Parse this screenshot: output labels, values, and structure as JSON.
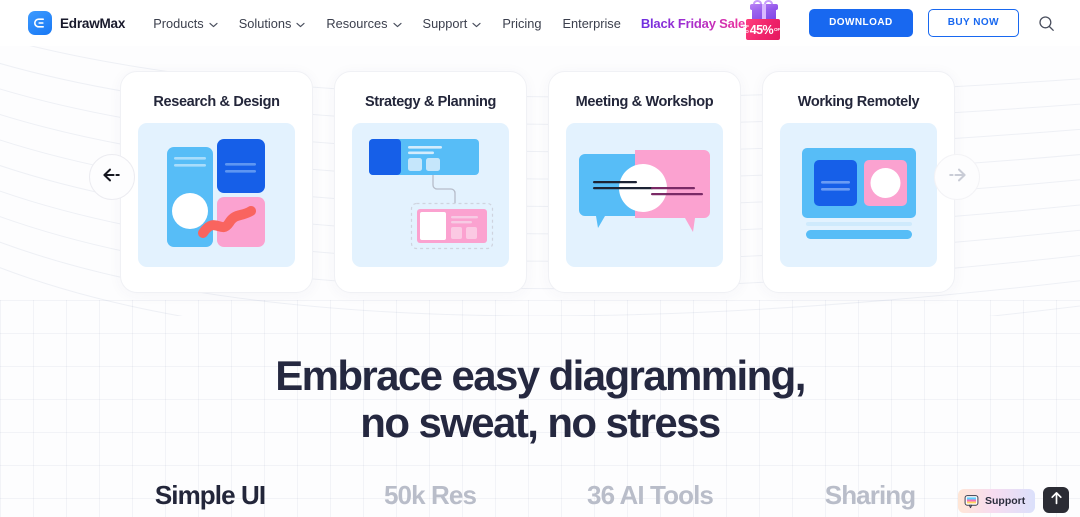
{
  "header": {
    "brand": {
      "name": "EdrawMax",
      "logo_icon": "edrawmax-logo-icon"
    },
    "nav": [
      {
        "label": "Products",
        "has_dropdown": true
      },
      {
        "label": "Solutions",
        "has_dropdown": true
      },
      {
        "label": "Resources",
        "has_dropdown": true
      },
      {
        "label": "Support",
        "has_dropdown": true
      },
      {
        "label": "Pricing",
        "has_dropdown": false
      },
      {
        "label": "Enterprise",
        "has_dropdown": false
      }
    ],
    "promo": {
      "text": "Black Friday Sale",
      "badge_upto": "UP TO",
      "badge_percent": "45%",
      "badge_off": "OFF",
      "icon": "gift-box-icon",
      "gradient_from": "#6d2fe0",
      "gradient_to": "#f0309b"
    },
    "download_label": "DOWNLOAD",
    "buy_label": "BUY NOW",
    "search_icon": "search-icon",
    "accent_color": "#1868f0"
  },
  "carousel": {
    "prev_icon": "arrow-left-icon",
    "next_icon": "arrow-right-icon",
    "prev_enabled": true,
    "next_enabled": false,
    "cards": [
      {
        "title": "Research & Design",
        "art": "research-design-illustration"
      },
      {
        "title": "Strategy & Planning",
        "art": "strategy-planning-illustration"
      },
      {
        "title": "Meeting & Workshop",
        "art": "meeting-workshop-illustration"
      },
      {
        "title": "Working Remotely",
        "art": "working-remotely-illustration"
      }
    ]
  },
  "hero": {
    "line1": "Embrace easy diagramming,",
    "line2": "no sweat, no stress"
  },
  "feature_tabs": [
    {
      "label": "Simple UI",
      "active": true
    },
    {
      "label": "50k Res",
      "active": false
    },
    {
      "label": "36 AI Tools",
      "active": false
    },
    {
      "label": "Sharing",
      "active": false
    }
  ],
  "widgets": {
    "support_label": "Support",
    "support_icon": "support-chat-icon",
    "to_top_icon": "arrow-up-icon"
  }
}
